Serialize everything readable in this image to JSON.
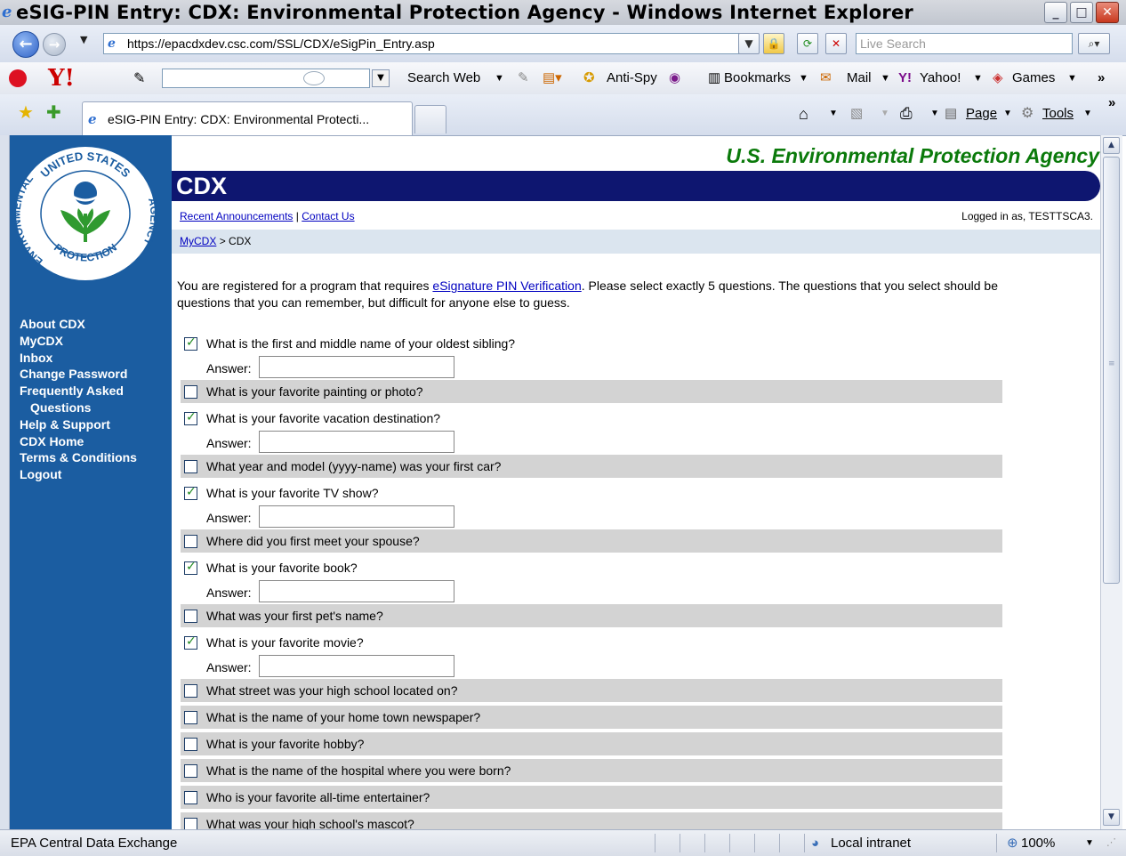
{
  "window": {
    "title": "eSIG-PIN Entry: CDX: Environmental Protection Agency - Windows Internet Explorer"
  },
  "address_bar": {
    "url": "https://epacdxdev.csc.com/SSL/CDX/eSigPin_Entry.asp",
    "search_placeholder": "Live Search"
  },
  "yahoo_toolbar": {
    "search_button": "Search Web",
    "anti_spy": "Anti-Spy",
    "bookmarks": "Bookmarks",
    "mail": "Mail",
    "yahoo": "Yahoo!",
    "games": "Games"
  },
  "tabs": [
    {
      "label": "eSIG-PIN Entry: CDX: Environmental Protecti..."
    }
  ],
  "command_bar": {
    "page": "Page",
    "tools": "Tools"
  },
  "page": {
    "agency_title": "U.S. Environmental Protection Agency",
    "cdx_title": "CDX",
    "links": {
      "recent_announcements": "Recent Announcements",
      "separator": "|",
      "contact_us": "Contact Us"
    },
    "logged_in": "Logged in as, TESTTSCA3.",
    "breadcrumb": {
      "mycdx": "MyCDX",
      "separator": ">",
      "current": "CDX"
    },
    "seal_text": {
      "top": "UNITED STATES",
      "left": "ENVIRONMENTAL",
      "bottom": "PROTECTION",
      "right": "AGENCY"
    },
    "intro": {
      "before_link": "You are registered for a program that requires ",
      "link": "eSignature PIN Verification",
      "after_link": ". Please select exactly 5 questions. The questions that you select should be questions that you can remember, but difficult for anyone else to guess."
    },
    "answer_label": "Answer:",
    "sidebar": [
      {
        "label": "About CDX"
      },
      {
        "label": "MyCDX"
      },
      {
        "label": "Inbox"
      },
      {
        "label": "Change Password"
      },
      {
        "label": "Frequently Asked"
      },
      {
        "label": "Questions"
      },
      {
        "label": "Help & Support"
      },
      {
        "label": "CDX Home"
      },
      {
        "label": "Terms & Conditions"
      },
      {
        "label": "Logout"
      }
    ],
    "questions": [
      {
        "text": "What is the first and middle name of your oldest sibling?",
        "checked": true,
        "answer": ""
      },
      {
        "text": "What is your favorite painting or photo?",
        "checked": false
      },
      {
        "text": "What is your favorite vacation destination?",
        "checked": true,
        "answer": ""
      },
      {
        "text": "What year and model (yyyy-name) was your first car?",
        "checked": false
      },
      {
        "text": "What is your favorite TV show?",
        "checked": true,
        "answer": ""
      },
      {
        "text": "Where did you first meet your spouse?",
        "checked": false
      },
      {
        "text": "What is your favorite book?",
        "checked": true,
        "answer": ""
      },
      {
        "text": "What was your first pet's name?",
        "checked": false
      },
      {
        "text": "What is your favorite movie?",
        "checked": true,
        "answer": ""
      },
      {
        "text": "What street was your high school located on?",
        "checked": false
      },
      {
        "text": "What is the name of your home town newspaper?",
        "checked": false
      },
      {
        "text": "What is your favorite hobby?",
        "checked": false
      },
      {
        "text": "What is the name of the hospital where you were born?",
        "checked": false
      },
      {
        "text": "Who is your favorite all-time entertainer?",
        "checked": false
      },
      {
        "text": "What was your high school's mascot?",
        "checked": false
      }
    ]
  },
  "status_bar": {
    "text": "EPA Central Data Exchange",
    "zone": "Local intranet",
    "zoom": "100%"
  },
  "colors": {
    "sidebar": "#1b5da1",
    "cdx_bar": "#0e1670",
    "agency_title": "#0b7a0b",
    "breadcrumb_bg": "#dbe5ef",
    "shaded_row": "#d3d3d3",
    "link": "#0000c0"
  }
}
